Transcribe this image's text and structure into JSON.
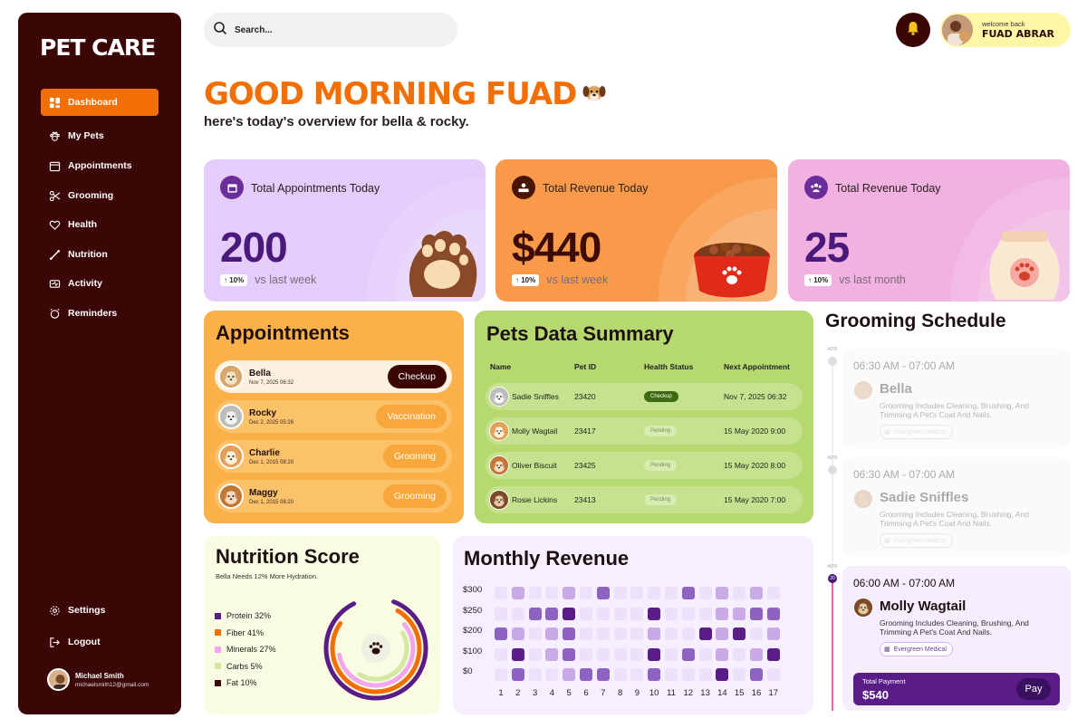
{
  "sidebar": {
    "logo": "PET CARE",
    "items": [
      {
        "label": "Dashboard",
        "icon": "grid-icon",
        "active": true
      },
      {
        "label": "My Pets",
        "icon": "paw-icon"
      },
      {
        "label": "Appointments",
        "icon": "calendar-icon"
      },
      {
        "label": "Grooming",
        "icon": "scissors-icon"
      },
      {
        "label": "Health",
        "icon": "heart-icon"
      },
      {
        "label": "Nutrition",
        "icon": "bone-icon"
      },
      {
        "label": "Activity",
        "icon": "activity-icon"
      },
      {
        "label": "Reminders",
        "icon": "alarm-icon"
      }
    ],
    "bottom": [
      {
        "label": "Settings",
        "icon": "gear-icon"
      },
      {
        "label": "Logout",
        "icon": "logout-icon"
      }
    ],
    "user": {
      "name": "Michael Smith",
      "email": "michaelsmith12@gmail.com"
    }
  },
  "header": {
    "search_placeholder": "Search...",
    "welcome": "welcome back",
    "user_name": "FUAD ABRAR"
  },
  "greeting": {
    "title": "GOOD MORNING FUAD",
    "subtitle": "here's today's overview for bella & rocky."
  },
  "stats": [
    {
      "label": "Total Appointments Today",
      "value": "200",
      "change": "10%",
      "period": "vs last week",
      "icon": "calendar-icon",
      "bg": "#e4ccfb",
      "accent": "#6b2d99",
      "value_color": "#4a1a7a"
    },
    {
      "label": "Total Revenue Today",
      "value": "$440",
      "change": "10%",
      "period": "vs last week",
      "icon": "money-icon",
      "bg": "#f99a4b",
      "accent": "#4a1506",
      "value_color": "#3d0d05"
    },
    {
      "label": "Total Revenue Today",
      "value": "25",
      "change": "10%",
      "period": "vs last month",
      "icon": "users-icon",
      "bg": "#f1b2e2",
      "accent": "#6b2d99",
      "value_color": "#4a1a7a"
    }
  ],
  "appointments": {
    "title": "Appointments",
    "items": [
      {
        "name": "Bella",
        "date": "Nov 7, 2025 06:32",
        "tag": "Checkup"
      },
      {
        "name": "Rocky",
        "date": "Dec 2, 2025 05:26",
        "tag": "Vaccination"
      },
      {
        "name": "Charlie",
        "date": "Dec 1, 2015 08:20",
        "tag": "Grooming"
      },
      {
        "name": "Maggy",
        "date": "Dec 1, 2015 08:20",
        "tag": "Grooming"
      }
    ]
  },
  "pets_summary": {
    "title": "Pets Data Summary",
    "columns": [
      "Name",
      "Pet ID",
      "Health Status",
      "Next Appointment"
    ],
    "rows": [
      {
        "name": "Sadie Sniffles",
        "id": "23420",
        "status": "Checkup",
        "next": "Nov 7, 2025 06:32"
      },
      {
        "name": "Molly Wagtail",
        "id": "23417",
        "status": "Pending",
        "next": "15 May 2020 9:00"
      },
      {
        "name": "Oliver Biscuit",
        "id": "23425",
        "status": "Pending",
        "next": "15 May 2020 8:00"
      },
      {
        "name": "Rosie Lickins",
        "id": "23413",
        "status": "Pending",
        "next": "15 May 2020 7:00"
      }
    ]
  },
  "grooming": {
    "title": "Grooming Schedule",
    "items": [
      {
        "month": "APR",
        "day": "",
        "time": "06:30 AM - 07:00 AM",
        "pet": "Bella",
        "desc": "Grooming Includes Cleaning, Brushing, And Trimming A Pet's Coat And Nails.",
        "location": "Evergreen Medical"
      },
      {
        "month": "APR",
        "day": "",
        "time": "06:30 AM - 07:00 AM",
        "pet": "Sadie Sniffles",
        "desc": "Grooming Includes Cleaning, Brushing, And Trimming A Pet's Coat And Nails.",
        "location": "Evergreen Medical"
      },
      {
        "month": "APR",
        "day": "20",
        "time": "06:00 AM - 07:00 AM",
        "pet": "Molly Wagtail",
        "desc": "Grooming Includes Cleaning, Brushing, And Trimming A Pet's Coat And Nails.",
        "location": "Evergreen Medical",
        "payment_label": "Total Payment",
        "payment_value": "$540",
        "pay_button": "Pay"
      }
    ]
  },
  "nutrition": {
    "title": "Nutrition Score",
    "note": "Bella Needs 12% More Hydration.",
    "legend": [
      {
        "label": "Protein 32%",
        "color": "#5a1c87"
      },
      {
        "label": "Fiber 41%",
        "color": "#f26f06"
      },
      {
        "label": "Minerals 27%",
        "color": "#f2a6ec"
      },
      {
        "label": "Carbs 5%",
        "color": "#d4e8a4"
      },
      {
        "label": "Fat 10%",
        "color": "#3a0606"
      }
    ]
  },
  "chart_data": {
    "type": "heatmap",
    "title": "Monthly Revenue",
    "y_labels": [
      "$300",
      "$250",
      "$200",
      "$100",
      "$0"
    ],
    "x_labels": [
      "1",
      "2",
      "3",
      "4",
      "5",
      "6",
      "7",
      "8",
      "9",
      "10",
      "11",
      "12",
      "13",
      "14",
      "15",
      "16",
      "17"
    ],
    "levels": [
      [
        1,
        2,
        1,
        1,
        2,
        1,
        3,
        1,
        1,
        1,
        1,
        3,
        1,
        2,
        1,
        2,
        1
      ],
      [
        1,
        1,
        3,
        3,
        4,
        1,
        1,
        1,
        1,
        4,
        1,
        1,
        1,
        2,
        2,
        3,
        3
      ],
      [
        3,
        2,
        1,
        2,
        3,
        1,
        1,
        1,
        1,
        2,
        1,
        1,
        4,
        2,
        4,
        1,
        2
      ],
      [
        1,
        4,
        1,
        2,
        3,
        1,
        1,
        1,
        1,
        4,
        1,
        3,
        1,
        2,
        1,
        2,
        4
      ],
      [
        1,
        3,
        1,
        1,
        2,
        3,
        3,
        1,
        1,
        3,
        1,
        1,
        1,
        4,
        1,
        3,
        1
      ]
    ],
    "colors": [
      "#ece0fa",
      "#c9a9e6",
      "#8e62c0",
      "#5a1c87"
    ]
  }
}
